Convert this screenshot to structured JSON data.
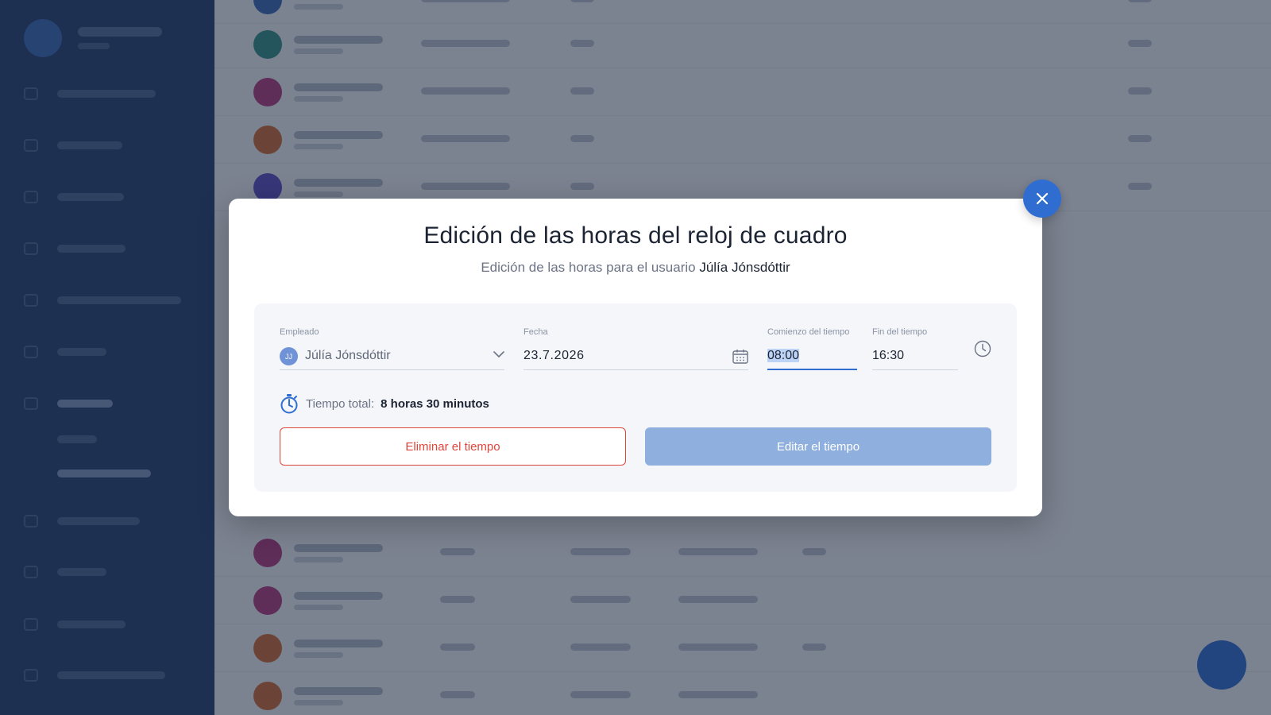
{
  "modal": {
    "title": "Edición de las horas del reloj de cuadro",
    "subtitle_prefix": "Edición de las horas para el usuario",
    "subtitle_user": "Júlía Jónsdóttir",
    "employee": {
      "label": "Empleado",
      "value": "Júlía Jónsdóttir",
      "initials": "JJ"
    },
    "date": {
      "label": "Fecha",
      "value": "23.7.2026"
    },
    "start_time": {
      "label": "Comienzo del tiempo",
      "value": "08:00"
    },
    "end_time": {
      "label": "Fin del tiempo",
      "value": "16:30"
    },
    "total": {
      "label": "Tiempo total:",
      "value": "8 horas 30 minutos"
    },
    "delete_label": "Eliminar el tiempo",
    "edit_label": "Editar el tiempo"
  },
  "icons": {
    "close": "close-icon",
    "calendar": "calendar-icon",
    "clock": "clock-icon",
    "stopwatch": "stopwatch-icon",
    "chevron": "chevron-down-icon"
  },
  "colors": {
    "accent": "#2f6dd0",
    "danger": "#e0453a",
    "edit_button": "#8fb0de",
    "sidebar": "#1d3a6c"
  }
}
